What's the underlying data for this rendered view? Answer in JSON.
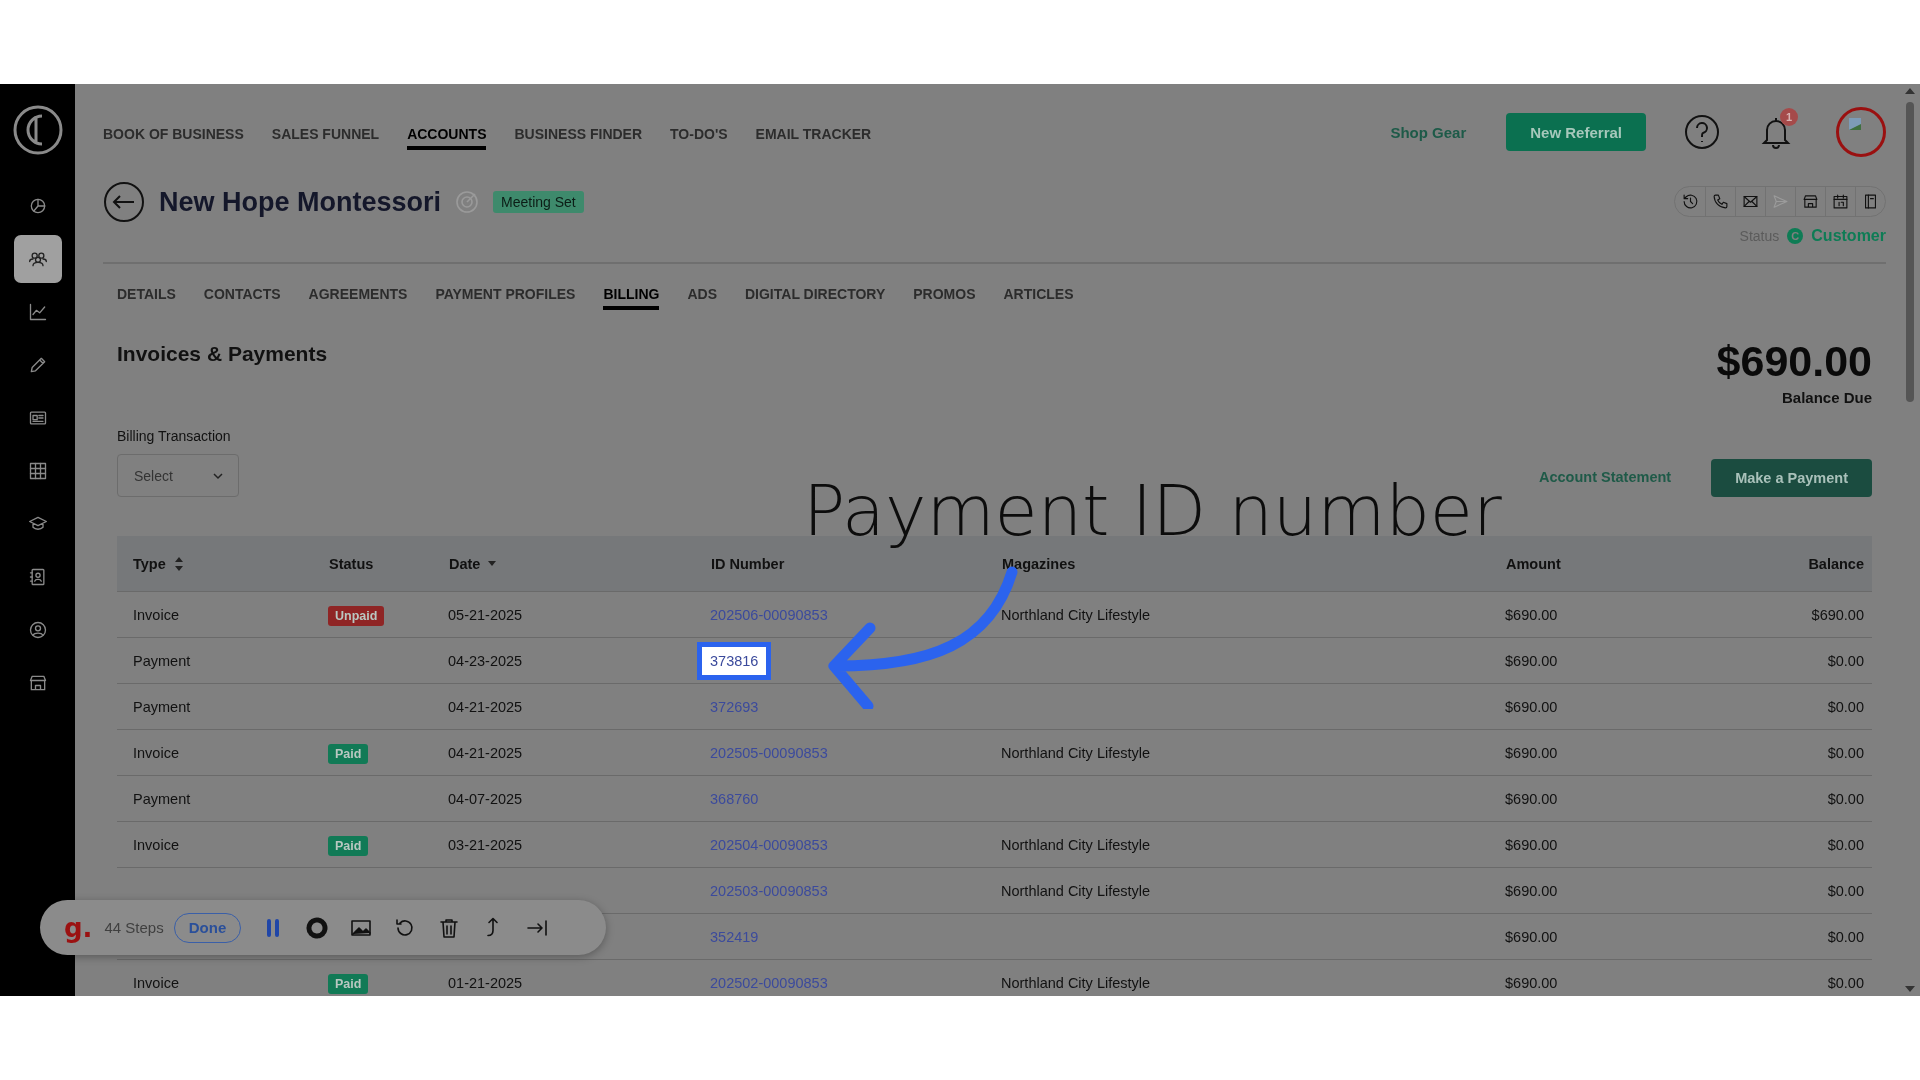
{
  "sidebar": {
    "items": [
      {
        "selected": false
      },
      {
        "selected": true
      },
      {
        "selected": false
      },
      {
        "selected": false
      },
      {
        "selected": false
      },
      {
        "selected": false
      },
      {
        "selected": false
      },
      {
        "selected": false
      },
      {
        "selected": false
      },
      {
        "selected": false
      }
    ]
  },
  "nav": [
    {
      "label": "BOOK OF BUSINESS",
      "selected": false
    },
    {
      "label": "SALES FUNNEL",
      "selected": false
    },
    {
      "label": "ACCOUNTS",
      "selected": true
    },
    {
      "label": "BUSINESS FINDER",
      "selected": false
    },
    {
      "label": "TO-DO'S",
      "selected": false
    },
    {
      "label": "EMAIL TRACKER",
      "selected": false
    }
  ],
  "header": {
    "shop_link": "Shop Gear",
    "primary_button": "New Referral",
    "notification_count": "1"
  },
  "account": {
    "title": "New Hope Montessori",
    "badge": "Meeting Set",
    "actions": [
      {
        "disabled": false
      },
      {
        "disabled": false
      },
      {
        "disabled": false
      },
      {
        "disabled": true
      },
      {
        "disabled": false
      },
      {
        "disabled": false
      },
      {
        "disabled": false
      }
    ],
    "status_label": "Status",
    "status_letter": "C",
    "status_value": "Customer"
  },
  "tabs": [
    {
      "label": "DETAILS",
      "selected": false
    },
    {
      "label": "CONTACTS",
      "selected": false
    },
    {
      "label": "AGREEMENTS",
      "selected": false
    },
    {
      "label": "PAYMENT PROFILES",
      "selected": false
    },
    {
      "label": "BILLING",
      "selected": true
    },
    {
      "label": "ADS",
      "selected": false
    },
    {
      "label": "DIGITAL DIRECTORY",
      "selected": false
    },
    {
      "label": "PROMOS",
      "selected": false
    },
    {
      "label": "ARTICLES",
      "selected": false
    }
  ],
  "billing": {
    "heading": "Invoices & Payments",
    "balance": "$690.00",
    "balance_label": "Balance Due",
    "filter_label": "Billing Transaction",
    "filter_placeholder": "Select",
    "statement_link": "Account Statement",
    "payment_button": "Make a Payment"
  },
  "table": {
    "columns": [
      "Type",
      "Status",
      "Date",
      "ID Number",
      "Magazines",
      "Amount",
      "Balance"
    ],
    "rows": [
      {
        "type": "Invoice",
        "status": {
          "label": "Unpaid",
          "color": "#8f2525"
        },
        "date": "05-21-2025",
        "id": "202506-00090853",
        "highlighted": false,
        "magazine": "Northland City Lifestyle",
        "amount": "$690.00",
        "balance": "$690.00"
      },
      {
        "type": "Payment",
        "date": "04-23-2025",
        "id": "373816",
        "highlighted": true,
        "amount": "$690.00",
        "balance": "$0.00"
      },
      {
        "type": "Payment",
        "date": "04-21-2025",
        "id": "372693",
        "highlighted": false,
        "amount": "$690.00",
        "balance": "$0.00"
      },
      {
        "type": "Invoice",
        "status": {
          "label": "Paid",
          "color": "#117a56"
        },
        "date": "04-21-2025",
        "id": "202505-00090853",
        "highlighted": false,
        "magazine": "Northland City Lifestyle",
        "amount": "$690.00",
        "balance": "$0.00"
      },
      {
        "type": "Payment",
        "date": "04-07-2025",
        "id": "368760",
        "highlighted": false,
        "amount": "$690.00",
        "balance": "$0.00"
      },
      {
        "type": "Invoice",
        "status": {
          "label": "Paid",
          "color": "#117a56"
        },
        "date": "03-21-2025",
        "id": "202504-00090853",
        "highlighted": false,
        "magazine": "Northland City Lifestyle",
        "amount": "$690.00",
        "balance": "$0.00"
      },
      {
        "id": "202503-00090853",
        "highlighted": false,
        "magazine": "Northland City Lifestyle",
        "amount": "$690.00",
        "balance": "$0.00"
      },
      {
        "id": "352419",
        "highlighted": false,
        "amount": "$690.00",
        "balance": "$0.00"
      },
      {
        "type": "Invoice",
        "status": {
          "label": "Paid",
          "color": "#117a56"
        },
        "date": "01-21-2025",
        "id": "202502-00090853",
        "highlighted": false,
        "magazine": "Northland City Lifestyle",
        "amount": "$690.00",
        "balance": "$0.00"
      }
    ]
  },
  "annotation": {
    "text": "Payment ID number"
  },
  "recorder": {
    "logo": "g.",
    "steps": "44 Steps",
    "done": "Done"
  }
}
